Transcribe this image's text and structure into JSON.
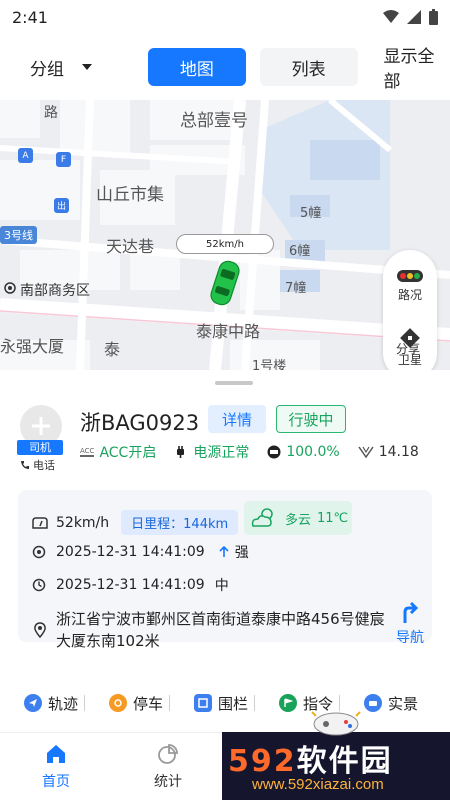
{
  "status_bar": {
    "time": "2:41"
  },
  "header": {
    "group_label": "分组",
    "tab_map": "地图",
    "tab_list": "列表",
    "show_all": "显示全部"
  },
  "map": {
    "labels": [
      "总部壹号",
      "山丘市集",
      "天达巷",
      "南部商务区",
      "泰康中路",
      "永强大厦",
      "泰",
      "5幢",
      "6幢",
      "7幢",
      "1号楼",
      "路"
    ],
    "line_badge": "3号线",
    "speed_label": "52km/h",
    "poi_badges": [
      "A",
      "F",
      "出"
    ]
  },
  "map_controls": {
    "traffic": "路况",
    "satellite": "卫星",
    "share_partial": "分享"
  },
  "vehicle": {
    "role": "司机",
    "phone_label": "电话",
    "plate": "浙BAG0923",
    "detail_button": "详情",
    "state": "行驶中",
    "acc_label": "ACC",
    "acc": "ACC开启",
    "power": "电源正常",
    "battery": "100.0%",
    "signal": "14.18"
  },
  "info_card": {
    "speed": "52km/h",
    "daily_mileage": "日里程：144km",
    "weather_desc": "多云",
    "temperature": "11℃",
    "gps_time": "2025-12-31 14:41:09",
    "signal_strength": "强",
    "report_time": "2025-12-31 14:41:09",
    "report_strength": "中",
    "address": "浙江省宁波市鄞州区首南街道泰康中路456号健宸大厦东南102米",
    "navigate": "导航"
  },
  "actions": [
    "轨迹",
    "停车",
    "围栏",
    "指令",
    "实景"
  ],
  "bottom_nav": {
    "home": "首页",
    "stats": "统计"
  },
  "watermark": {
    "brand": "592软件园",
    "url": "www.592xiazai.com"
  },
  "colors": {
    "primary": "#1677ff",
    "green": "#18a35f"
  }
}
